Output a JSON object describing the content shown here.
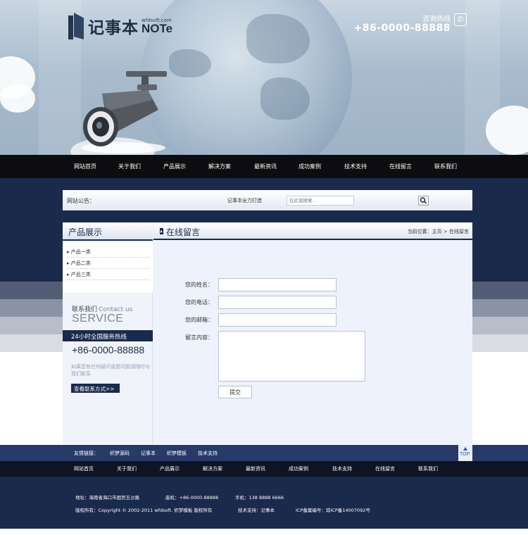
{
  "header": {
    "logo_cn": "记事本",
    "logo_site": "wfdsoft.com",
    "logo_en": "NOTe",
    "hotline_label": "咨询热线",
    "hotline_number": "+86-0000-88888"
  },
  "nav": {
    "items": [
      "网站首页",
      "关于我们",
      "产品展示",
      "解决方案",
      "最新资讯",
      "成功案例",
      "技术支持",
      "在线留言",
      "联系我们"
    ]
  },
  "notice": {
    "label": "网站公告：",
    "text": "记事本全力打造",
    "search_placeholder": "在此留搜索..."
  },
  "sidebar": {
    "title": "产品展示",
    "categories": [
      "产品一类",
      "产品二类",
      "产品三类"
    ],
    "contact_cn": "联系我们",
    "contact_en": "Contact us",
    "service": "SERVICE",
    "service_bar": "24小时全国服务热线",
    "phone": "+86-0000-88888",
    "desc": "如果您有任何疑问或是问题请随时与我们联系",
    "contact_button": "查看联系方式>>"
  },
  "content": {
    "title": "在线留言",
    "breadcrumb": "当前位置：主页 > 在线留言",
    "form": {
      "name_label": "您的姓名：",
      "phone_label": "您的电话：",
      "email_label": "您的邮箱：",
      "message_label": "留言内容：",
      "submit": "提交"
    }
  },
  "footer": {
    "friend_links": [
      "友情链接：",
      "织梦源码",
      "记事本",
      "织梦模板",
      "技术支持"
    ],
    "top_label": "TOP",
    "nav": [
      "网站首页",
      "关于我们",
      "产品展示",
      "解决方案",
      "最新资讯",
      "成功案例",
      "技术支持",
      "在线留言",
      "联系我们"
    ],
    "address": "地址：海南省海口市国贸玉沙路",
    "tel": "座机：+86-0000-88888",
    "mobile": "手机：138 8888 6666",
    "copyright": "版权所有：Copyright © 2002-2011 wfdsoft. 织梦模板 版权所有",
    "support": "技术支持：记事本",
    "icp": "ICP备案编号：琼ICP备14007092号"
  },
  "colors": {
    "navy": "#1a2a4d",
    "nav_black": "#0d0d0f",
    "panel_bg": "#eef2fc"
  },
  "icons": [
    "phone-icon",
    "search-icon",
    "arrow-up-icon",
    "camera-image",
    "logo-book-icon"
  ]
}
